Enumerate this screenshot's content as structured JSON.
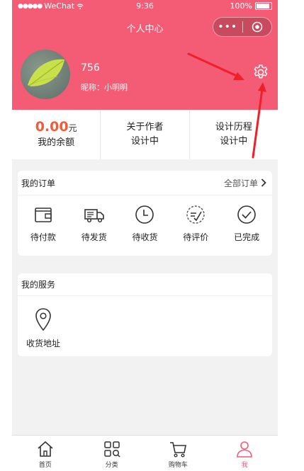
{
  "status_bar": {
    "carrier": "WeChat",
    "time": "9:36",
    "battery": "100%"
  },
  "nav": {
    "title": "个人中心",
    "more_glyph": "•••"
  },
  "profile": {
    "username": "756",
    "nickname": "昵称：小明明"
  },
  "stats": [
    {
      "value": "0.00",
      "unit": "元",
      "label": "我的余额"
    },
    {
      "line1": "关于作者",
      "line2": "设计中"
    },
    {
      "line1": "设计历程",
      "line2": "设计中"
    }
  ],
  "orders": {
    "title": "我的订单",
    "all_label": "全部订单",
    "items": [
      {
        "label": "待付款",
        "icon": "wallet-icon"
      },
      {
        "label": "待发货",
        "icon": "truck-icon"
      },
      {
        "label": "待收货",
        "icon": "clock-icon"
      },
      {
        "label": "待评价",
        "icon": "review-icon"
      },
      {
        "label": "已完成",
        "icon": "check-circle-icon"
      }
    ]
  },
  "services": {
    "title": "我的服务",
    "items": [
      {
        "label": "收货地址",
        "icon": "location-pin-icon"
      }
    ]
  },
  "tabbar": [
    {
      "label": "首页",
      "icon": "home-icon"
    },
    {
      "label": "分类",
      "icon": "category-icon"
    },
    {
      "label": "购物车",
      "icon": "cart-icon"
    },
    {
      "label": "我",
      "icon": "user-icon",
      "active": true
    }
  ],
  "colors": {
    "brand": "#f45b75",
    "balance": "#f45b3a",
    "annotation_arrow": "#f0202a"
  }
}
